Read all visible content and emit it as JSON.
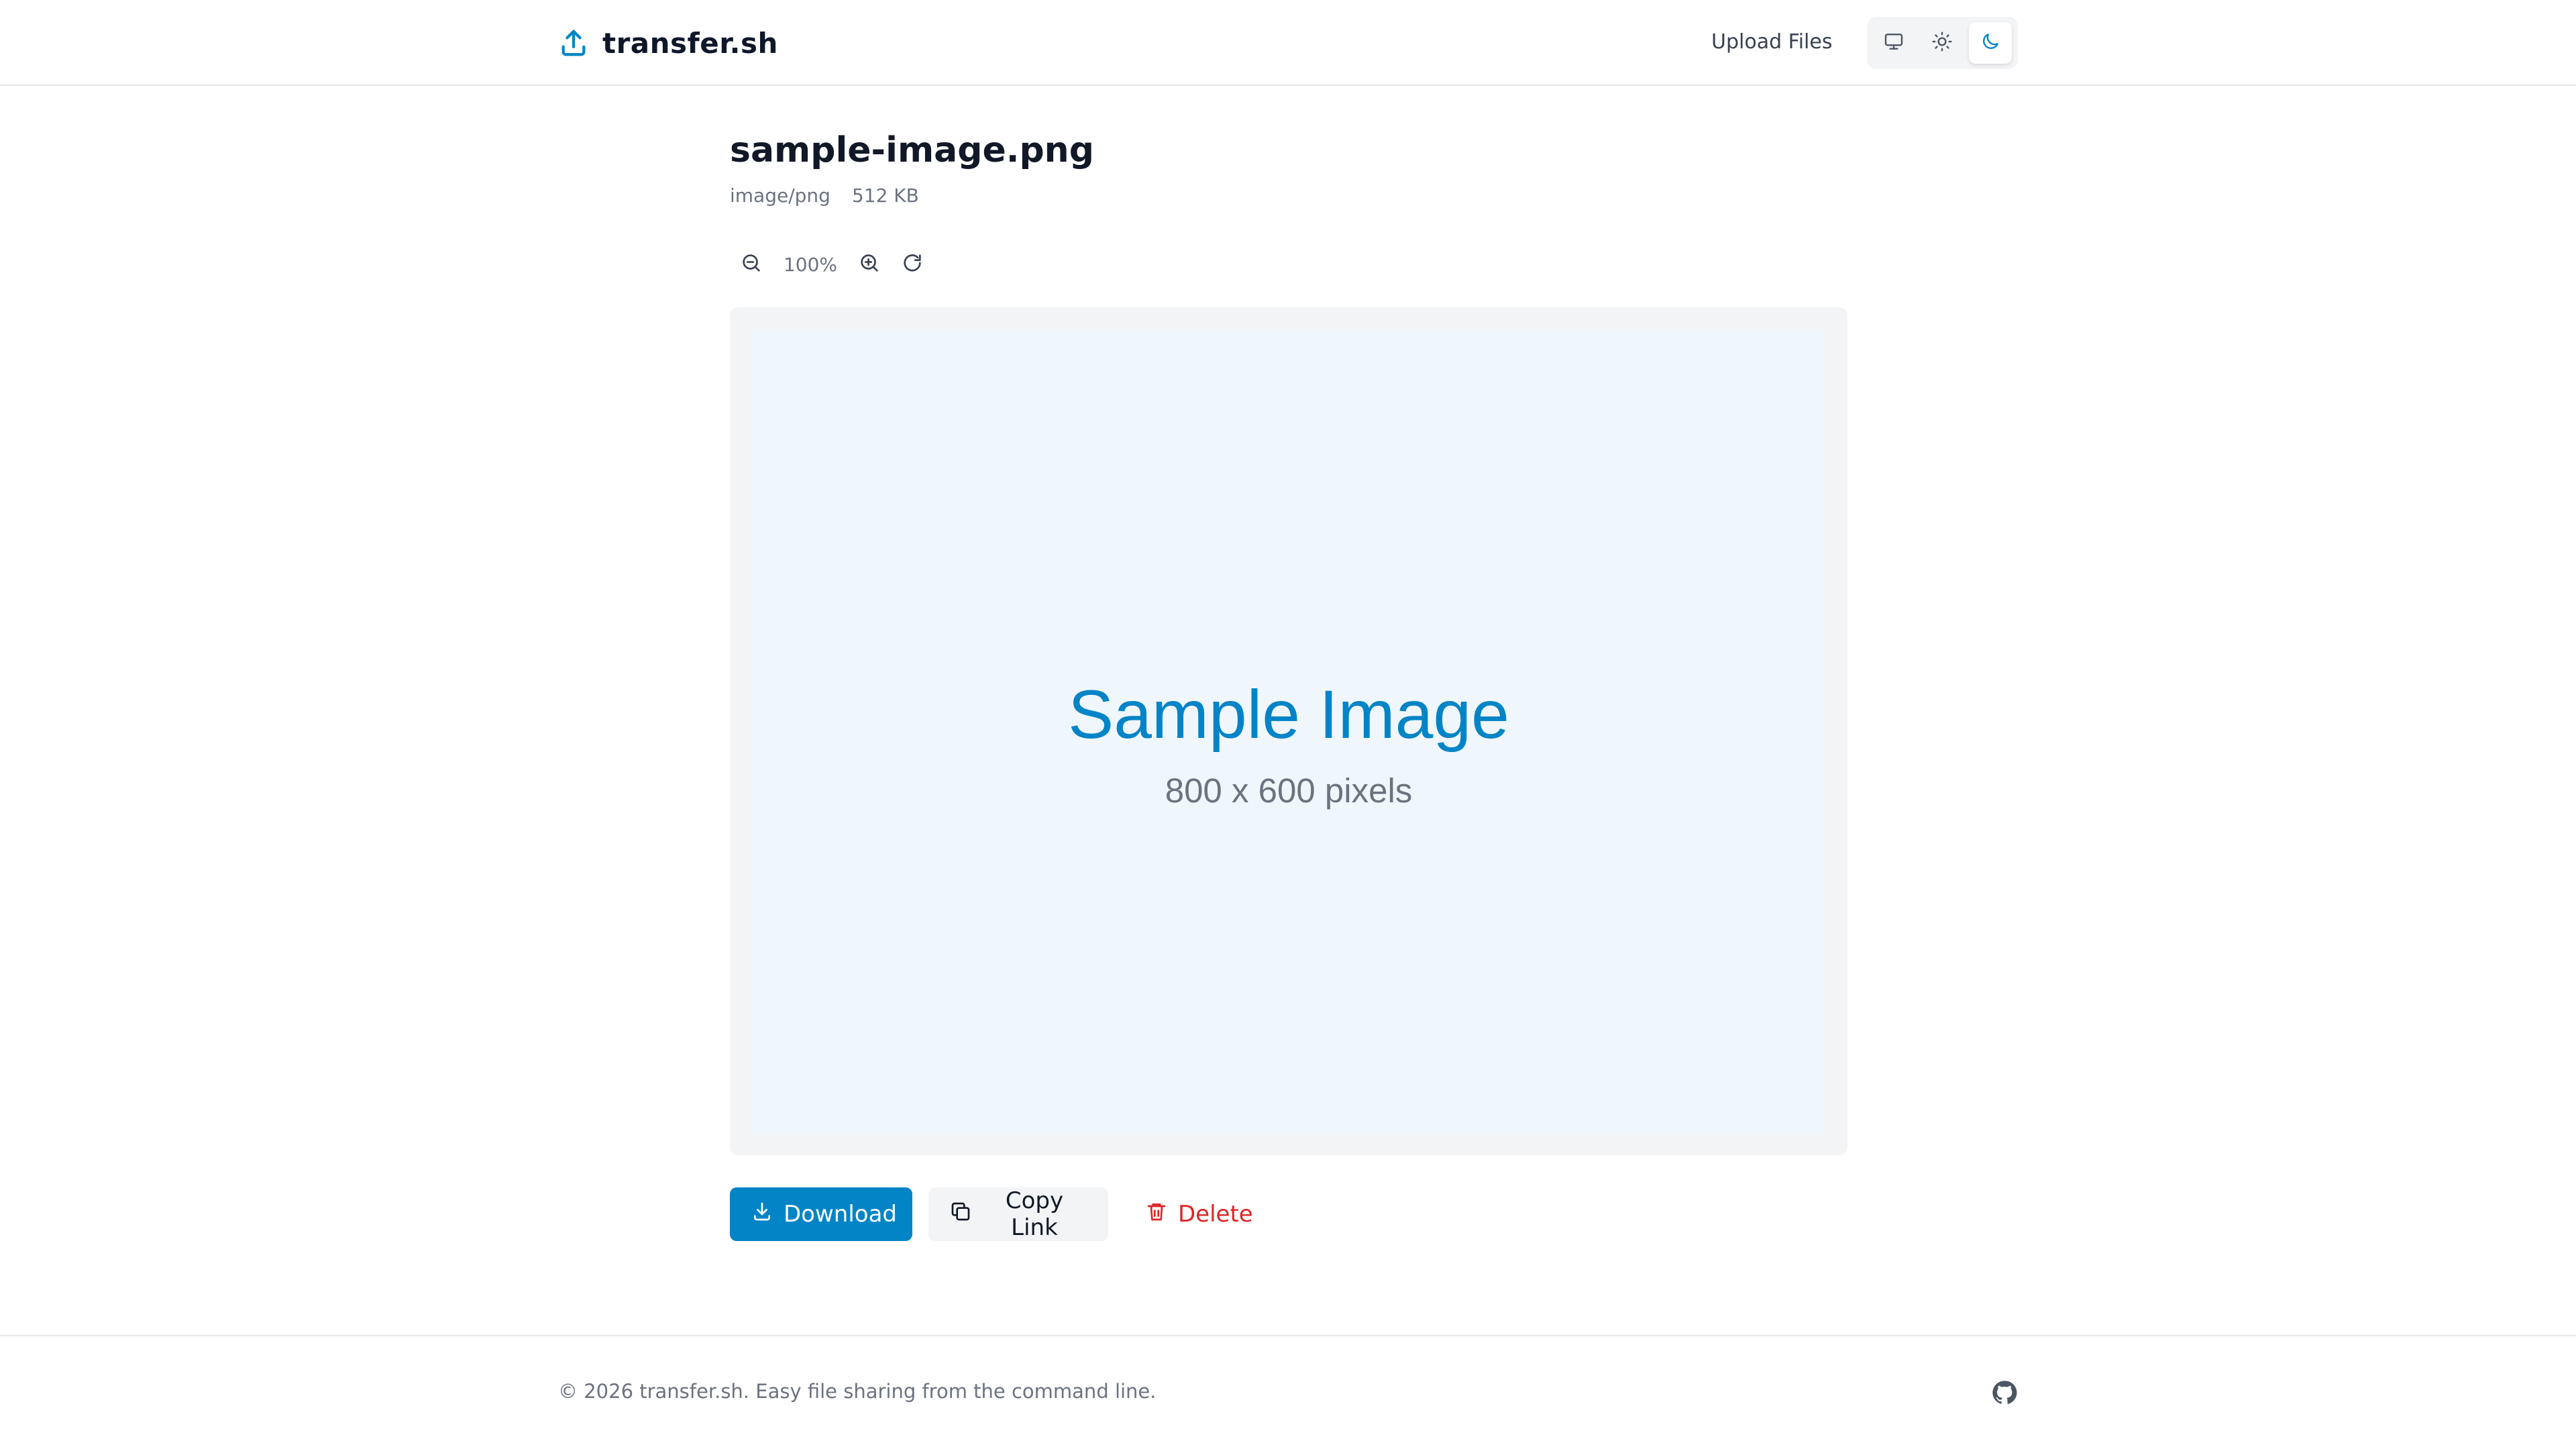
{
  "header": {
    "brand": "transfer.sh",
    "brand_icon": "upload-icon",
    "nav_upload": "Upload Files",
    "theme_options": [
      "system-monitor-icon",
      "sun-icon",
      "moon-icon"
    ],
    "theme_active": "moon-icon"
  },
  "file": {
    "name": "sample-image.png",
    "mime": "image/png",
    "size": "512 KB"
  },
  "viewer": {
    "zoom_level": "100%",
    "image_title": "Sample Image",
    "image_subtitle": "800 x 600 pixels"
  },
  "actions": {
    "download": "Download",
    "copy_link": "Copy Link",
    "delete": "Delete"
  },
  "footer": {
    "text": "© 2026 transfer.sh. Easy file sharing from the command line.",
    "github_icon": "github-icon"
  },
  "colors": {
    "accent": "#0284c7",
    "danger": "#dc2626",
    "text": "#111827",
    "muted": "#6b7280"
  }
}
